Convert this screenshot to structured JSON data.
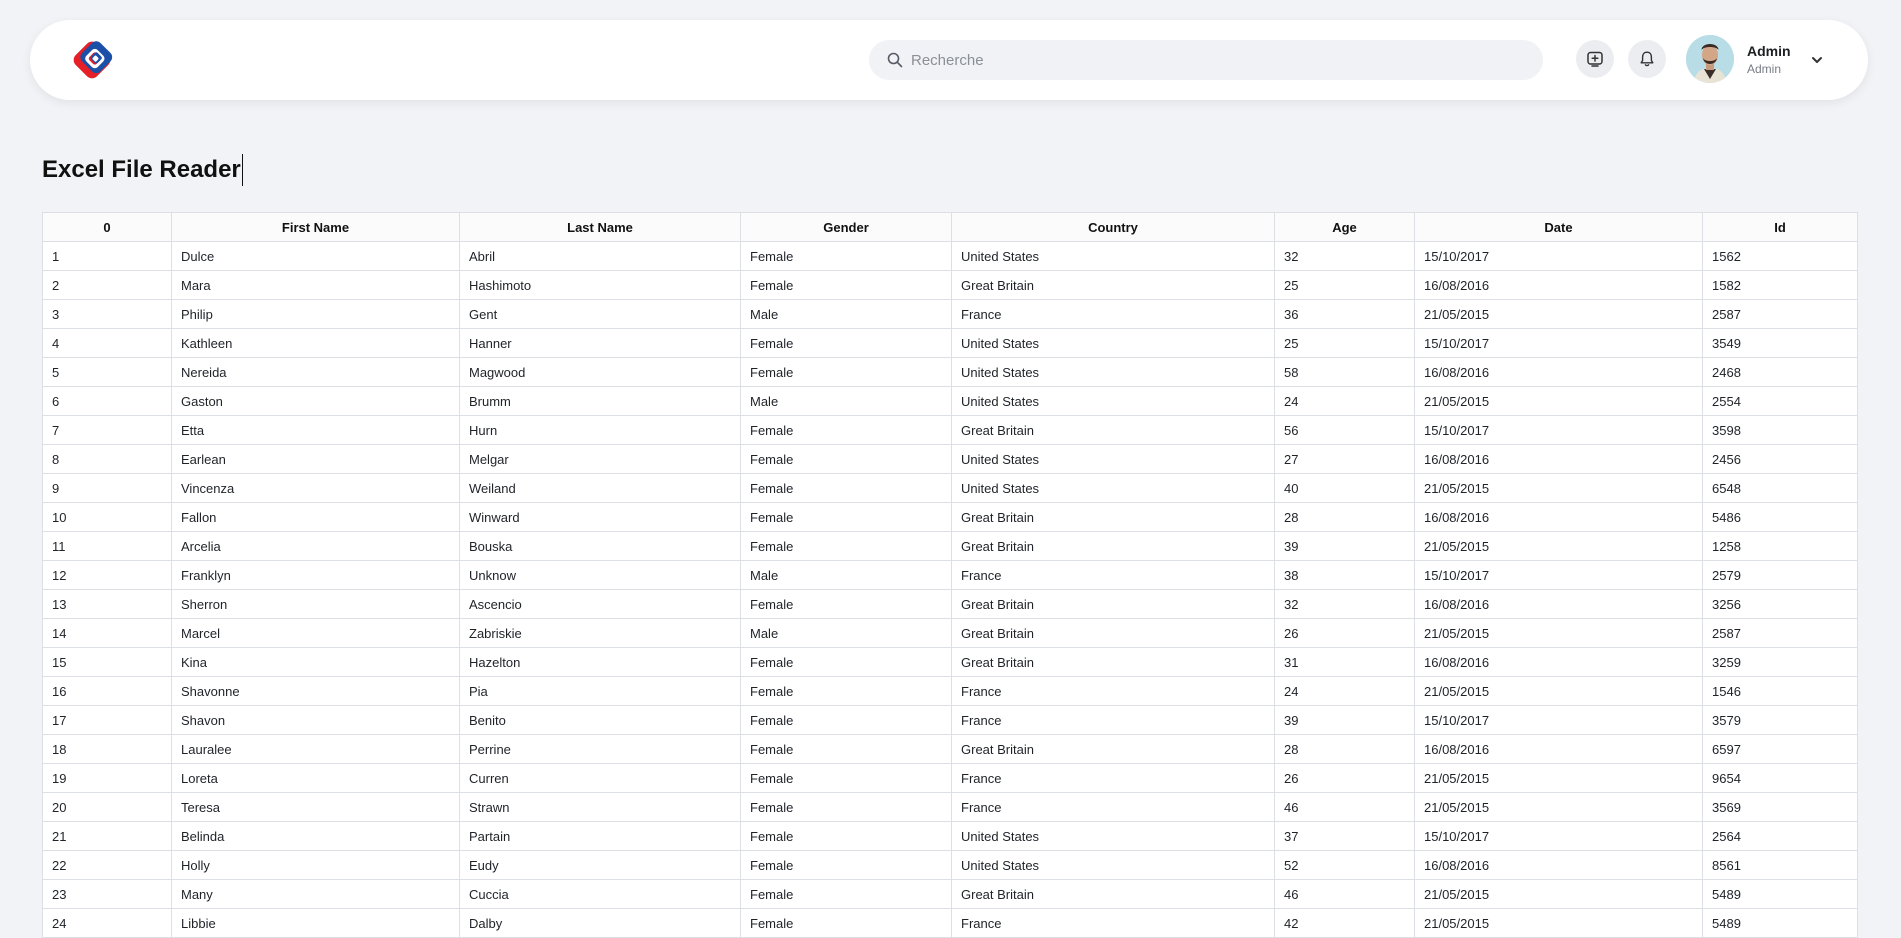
{
  "header": {
    "logo": "brand-logo",
    "search_placeholder": "Recherche",
    "user": {
      "name": "Admin",
      "role": "Admin"
    }
  },
  "page": {
    "title": "Excel File Reader"
  },
  "table": {
    "columns": [
      "0",
      "First Name",
      "Last Name",
      "Gender",
      "Country",
      "Age",
      "Date",
      "Id"
    ],
    "rows": [
      [
        "1",
        "Dulce",
        "Abril",
        "Female",
        "United States",
        "32",
        "15/10/2017",
        "1562"
      ],
      [
        "2",
        "Mara",
        "Hashimoto",
        "Female",
        "Great Britain",
        "25",
        "16/08/2016",
        "1582"
      ],
      [
        "3",
        "Philip",
        "Gent",
        "Male",
        "France",
        "36",
        "21/05/2015",
        "2587"
      ],
      [
        "4",
        "Kathleen",
        "Hanner",
        "Female",
        "United States",
        "25",
        "15/10/2017",
        "3549"
      ],
      [
        "5",
        "Nereida",
        "Magwood",
        "Female",
        "United States",
        "58",
        "16/08/2016",
        "2468"
      ],
      [
        "6",
        "Gaston",
        "Brumm",
        "Male",
        "United States",
        "24",
        "21/05/2015",
        "2554"
      ],
      [
        "7",
        "Etta",
        "Hurn",
        "Female",
        "Great Britain",
        "56",
        "15/10/2017",
        "3598"
      ],
      [
        "8",
        "Earlean",
        "Melgar",
        "Female",
        "United States",
        "27",
        "16/08/2016",
        "2456"
      ],
      [
        "9",
        "Vincenza",
        "Weiland",
        "Female",
        "United States",
        "40",
        "21/05/2015",
        "6548"
      ],
      [
        "10",
        "Fallon",
        "Winward",
        "Female",
        "Great Britain",
        "28",
        "16/08/2016",
        "5486"
      ],
      [
        "11",
        "Arcelia",
        "Bouska",
        "Female",
        "Great Britain",
        "39",
        "21/05/2015",
        "1258"
      ],
      [
        "12",
        "Franklyn",
        "Unknow",
        "Male",
        "France",
        "38",
        "15/10/2017",
        "2579"
      ],
      [
        "13",
        "Sherron",
        "Ascencio",
        "Female",
        "Great Britain",
        "32",
        "16/08/2016",
        "3256"
      ],
      [
        "14",
        "Marcel",
        "Zabriskie",
        "Male",
        "Great Britain",
        "26",
        "21/05/2015",
        "2587"
      ],
      [
        "15",
        "Kina",
        "Hazelton",
        "Female",
        "Great Britain",
        "31",
        "16/08/2016",
        "3259"
      ],
      [
        "16",
        "Shavonne",
        "Pia",
        "Female",
        "France",
        "24",
        "21/05/2015",
        "1546"
      ],
      [
        "17",
        "Shavon",
        "Benito",
        "Female",
        "France",
        "39",
        "15/10/2017",
        "3579"
      ],
      [
        "18",
        "Lauralee",
        "Perrine",
        "Female",
        "Great Britain",
        "28",
        "16/08/2016",
        "6597"
      ],
      [
        "19",
        "Loreta",
        "Curren",
        "Female",
        "France",
        "26",
        "21/05/2015",
        "9654"
      ],
      [
        "20",
        "Teresa",
        "Strawn",
        "Female",
        "France",
        "46",
        "21/05/2015",
        "3569"
      ],
      [
        "21",
        "Belinda",
        "Partain",
        "Female",
        "United States",
        "37",
        "15/10/2017",
        "2564"
      ],
      [
        "22",
        "Holly",
        "Eudy",
        "Female",
        "United States",
        "52",
        "16/08/2016",
        "8561"
      ],
      [
        "23",
        "Many",
        "Cuccia",
        "Female",
        "Great Britain",
        "46",
        "21/05/2015",
        "5489"
      ],
      [
        "24",
        "Libbie",
        "Dalby",
        "Female",
        "France",
        "42",
        "21/05/2015",
        "5489"
      ]
    ]
  }
}
